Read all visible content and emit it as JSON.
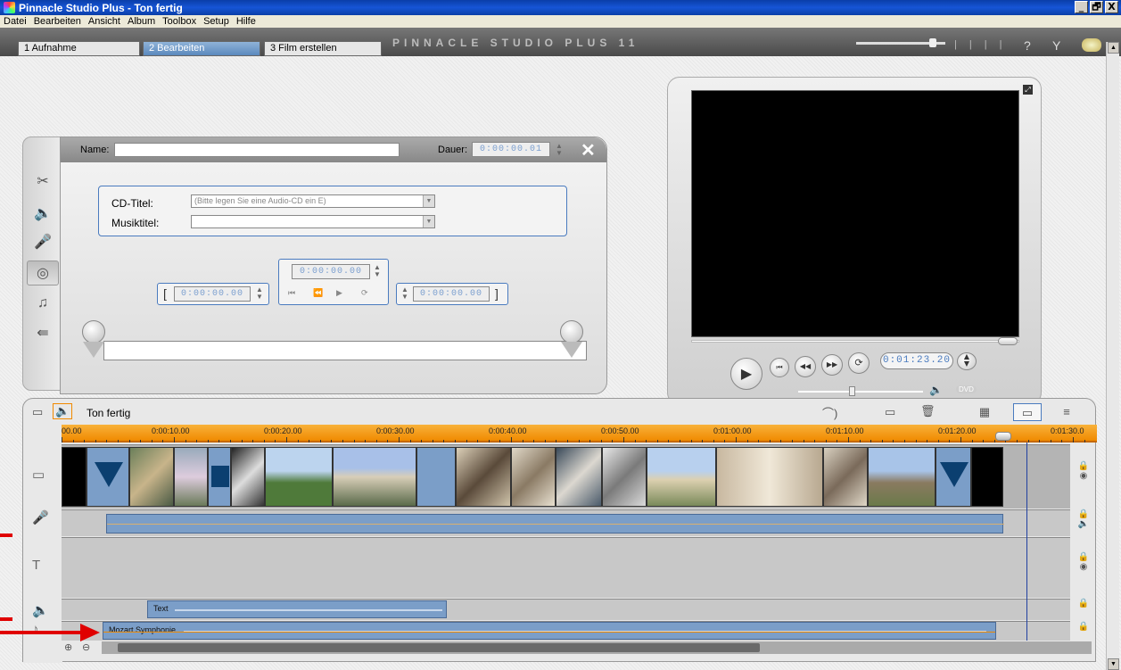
{
  "window": {
    "title": "Pinnacle Studio Plus - Ton fertig",
    "buttons": [
      "_",
      "🗗",
      "X"
    ]
  },
  "menu": [
    "Datei",
    "Bearbeiten",
    "Ansicht",
    "Album",
    "Toolbox",
    "Setup",
    "Hilfe"
  ],
  "tabs": [
    {
      "label": "1 Aufnahme"
    },
    {
      "label": "2 Bearbeiten"
    },
    {
      "label": "3 Film erstellen"
    }
  ],
  "brand": "PINNACLE STUDIO PLUS 11",
  "editor": {
    "name_label": "Name:",
    "name_value": "",
    "dauer_label": "Dauer:",
    "dauer_value": "0:00:00.01",
    "cd_label": "CD-Titel:",
    "cd_value": "(Bitte legen Sie eine Audio-CD ein E)",
    "track_label": "Musiktitel:",
    "track_value": "",
    "tc_top": "0:00:00.00",
    "tc_in": "0:00:00.00",
    "tc_out": "0:00:00.00"
  },
  "player": {
    "timecode": "0:01:23.20",
    "dvd_label": "DVD",
    "volume_level": 0.43
  },
  "timeline": {
    "title": "Ton fertig",
    "ruler": [
      "00.00",
      "0:00:10.00",
      "0:00:20.00",
      "0:00:30.00",
      "0:00:40.00",
      "0:00:50.00",
      "0:01:00.00",
      "0:01:10.00",
      "0:01:20.00",
      "0:01:30.0"
    ],
    "text_clip": "Text",
    "music_clip": "Mozart Symphonie"
  },
  "colors": {
    "title_bar": "#0a3ea8",
    "accent": "#4a7bbf",
    "ruler": "#f08a00",
    "clip_blue": "#7b9ec8",
    "annotation_arrow": "#e00000"
  }
}
